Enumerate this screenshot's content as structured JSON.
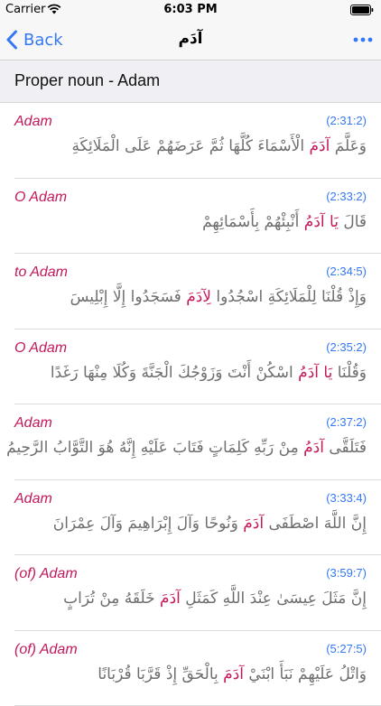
{
  "status_bar": {
    "carrier": "Carrier",
    "time": "6:03 PM"
  },
  "nav": {
    "back_label": "Back",
    "title": "آدَم"
  },
  "section": {
    "header": "Proper noun - Adam"
  },
  "colors": {
    "accent": "#3478f6",
    "highlight": "#c2185b",
    "verse_text": "#6e6e6e"
  },
  "rows": [
    {
      "gloss": "Adam",
      "ref": "(2:31:2)",
      "before": "وَعَلَّمَ ",
      "word": "آدَمَ",
      "after": " الْأَسْمَاءَ كُلَّهَا ثُمَّ عَرَضَهُمْ عَلَى الْمَلَائِكَةِ"
    },
    {
      "gloss": "O Adam",
      "ref": "(2:33:2)",
      "before": "قَالَ ",
      "word": "يَا آدَمُ",
      "after": " أَنْبِئْهُمْ بِأَسْمَائِهِمْ"
    },
    {
      "gloss": "to Adam",
      "ref": "(2:34:5)",
      "before": "وَإِذْ قُلْنَا لِلْمَلَائِكَةِ اسْجُدُوا ",
      "word": "لِآدَمَ",
      "after": " فَسَجَدُوا إِلَّا إِبْلِيسَ"
    },
    {
      "gloss": "O Adam",
      "ref": "(2:35:2)",
      "before": "وَقُلْنَا ",
      "word": "يَا آدَمُ",
      "after": " اسْكُنْ أَنْتَ وَزَوْجُكَ الْجَنَّةَ وَكُلَا مِنْهَا رَغَدًا"
    },
    {
      "gloss": "Adam",
      "ref": "(2:37:2)",
      "before": "فَتَلَقَّى ",
      "word": "آدَمُ",
      "after": " مِنْ رَبِّهِ كَلِمَاتٍ فَتَابَ عَلَيْهِ إِنَّهُ هُوَ التَّوَّابُ الرَّحِيمُ"
    },
    {
      "gloss": "Adam",
      "ref": "(3:33:4)",
      "before": "إِنَّ اللَّهَ اصْطَفَى ",
      "word": "آدَمَ",
      "after": " وَنُوحًا وَآلَ إِبْرَاهِيمَ وَآلَ عِمْرَانَ"
    },
    {
      "gloss": "(of) Adam",
      "ref": "(3:59:7)",
      "before": "إِنَّ مَثَلَ عِيسَىٰ عِنْدَ اللَّهِ كَمَثَلِ ",
      "word": "آدَمَ",
      "after": " خَلَقَهُ مِنْ تُرَابٍ"
    },
    {
      "gloss": "(of) Adam",
      "ref": "(5:27:5)",
      "before": "وَاتْلُ عَلَيْهِمْ نَبَأَ ابْنَيْ ",
      "word": "آدَمَ",
      "after": " بِالْحَقِّ إِذْ قَرَّبَا قُرْبَانًا"
    }
  ]
}
